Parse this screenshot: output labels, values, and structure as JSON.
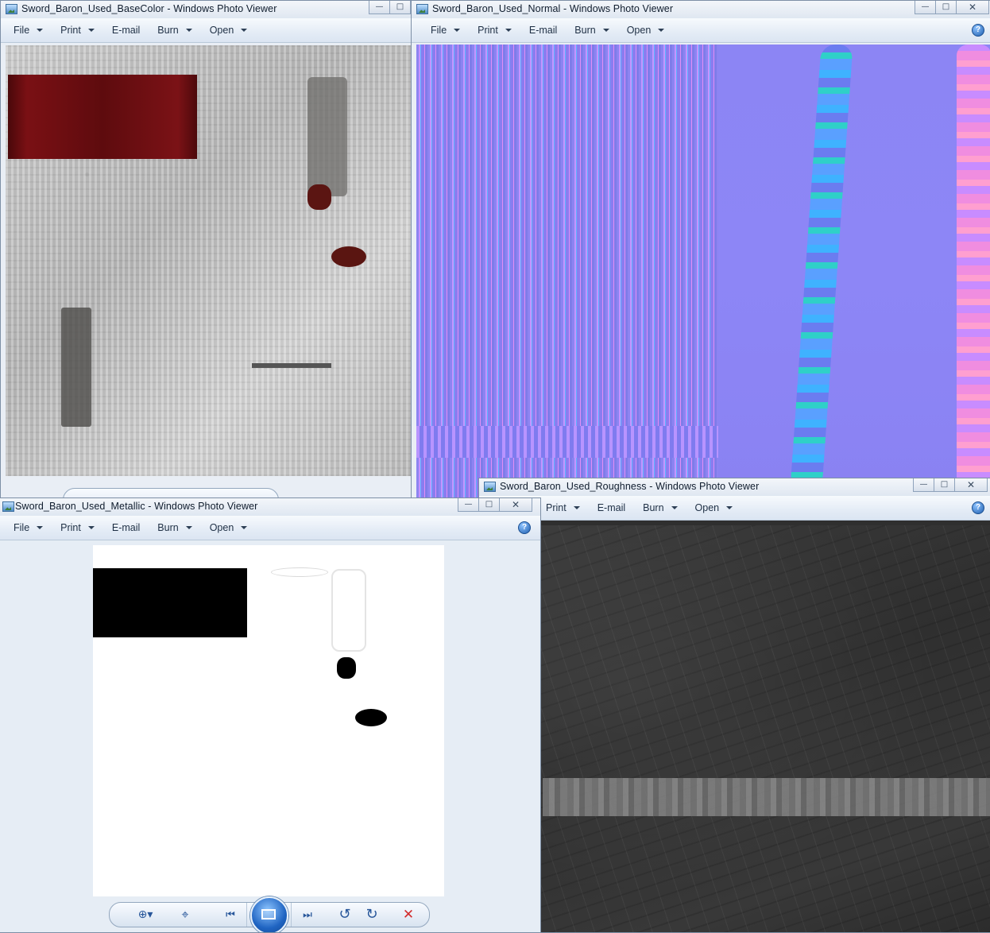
{
  "menu": [
    {
      "label": "File",
      "dropdown": true
    },
    {
      "label": "Print",
      "dropdown": true
    },
    {
      "label": "E-mail",
      "dropdown": false
    },
    {
      "label": "Burn",
      "dropdown": true
    },
    {
      "label": "Open",
      "dropdown": true
    }
  ],
  "caption_buttons": {
    "minimize": "—",
    "maximize": "□",
    "close": "✕"
  },
  "help_glyph": "?",
  "windows": {
    "basecolor": {
      "title": "Sword_Baron_Used_BaseColor - Windows Photo Viewer"
    },
    "normal": {
      "title": "Sword_Baron_Used_Normal - Windows Photo Viewer"
    },
    "metallic": {
      "title": "Sword_Baron_Used_Metallic - Windows Photo Viewer"
    },
    "roughness": {
      "title": "Sword_Baron_Used_Roughness - Windows Photo Viewer"
    }
  },
  "icons": {
    "app": "photo-viewer-icon",
    "zoom": "magnifier-zoom-icon",
    "actual_size": "actual-size-icon",
    "previous": "previous-icon",
    "slideshow": "slideshow-icon",
    "next": "next-icon",
    "rotate_ccw": "rotate-counterclockwise-icon",
    "rotate_cw": "rotate-clockwise-icon",
    "delete": "delete-icon"
  },
  "nav_glyphs": {
    "zoom": "⊕▾",
    "actual_size": "⌖",
    "previous": "⏮",
    "next": "⏭",
    "rotate_ccw": "↺",
    "rotate_cw": "↻",
    "delete": "✕"
  },
  "colors": {
    "basecolor_red": "#6b0d10",
    "normal_base": "#8a80f0",
    "metallic_black": "#000000",
    "roughness_dark": "#333333",
    "delete_red": "#d22b2b"
  }
}
